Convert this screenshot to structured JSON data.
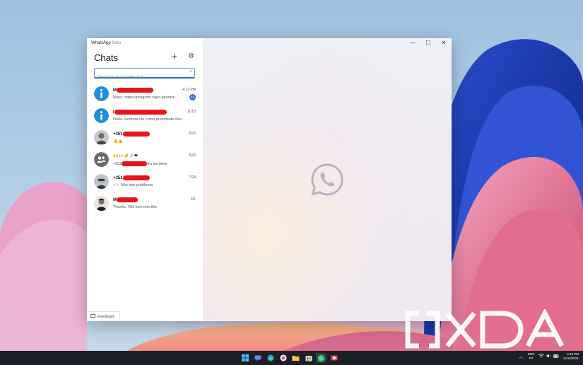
{
  "window": {
    "title": "WhatsApp",
    "title_badge": "Beta",
    "controls": {
      "minimize": "—",
      "maximize": "☐",
      "close": "✕"
    }
  },
  "sidebar": {
    "heading": "Chats",
    "new_chat_icon": "plus-icon",
    "settings_icon": "gear-icon",
    "search": {
      "placeholder": "Search or start a new chat",
      "icon": "search-icon"
    },
    "chats": [
      {
        "name": "M",
        "preview": "Nuno: https://poligrafo.sapo.pt/entre...",
        "time": "4:13 PM",
        "unread": "14",
        "avatar": "info"
      },
      {
        "name": "I",
        "preview": "Nuno: Embora ele como presidente dev...",
        "time": "11/15",
        "avatar": "info"
      },
      {
        "name": "+351",
        "preview": "👍👍",
        "time": "8/23",
        "avatar": "photo-gray"
      },
      {
        "name": "🙌🙌🏻🤌🤌🏻❤",
        "preview_prefix": "+351",
        "preview": "Eu também",
        "time": "8/20",
        "avatar": "group"
      },
      {
        "name": "+351",
        "preview": "✓✓ Não tem problema",
        "time": "7/24",
        "avatar": "photo-sunglasses"
      },
      {
        "name": "M",
        "preview": "Thanks. Will look into this",
        "time": "6/1",
        "avatar": "photo-person"
      }
    ],
    "feedback_label": "Feedback"
  },
  "main": {
    "logo_icon": "whatsapp-logo-icon"
  },
  "watermark": {
    "text": "XDA"
  },
  "taskbar": {
    "apps": [
      "windows-start-icon",
      "teams-chat-icon",
      "edge-icon",
      "photos-icon",
      "file-explorer-icon",
      "store-icon",
      "whatsapp-icon",
      "snipping-icon"
    ],
    "tray": {
      "lang_top": "ENG",
      "lang_bottom": "PT",
      "time": "4:40 PM",
      "date": "11/16/2021"
    }
  },
  "colors": {
    "accent": "#3b6fc6",
    "redaction": "#e8141b",
    "whatsapp_logo": "#b9b3c0",
    "taskbar": "#1d1f26"
  }
}
